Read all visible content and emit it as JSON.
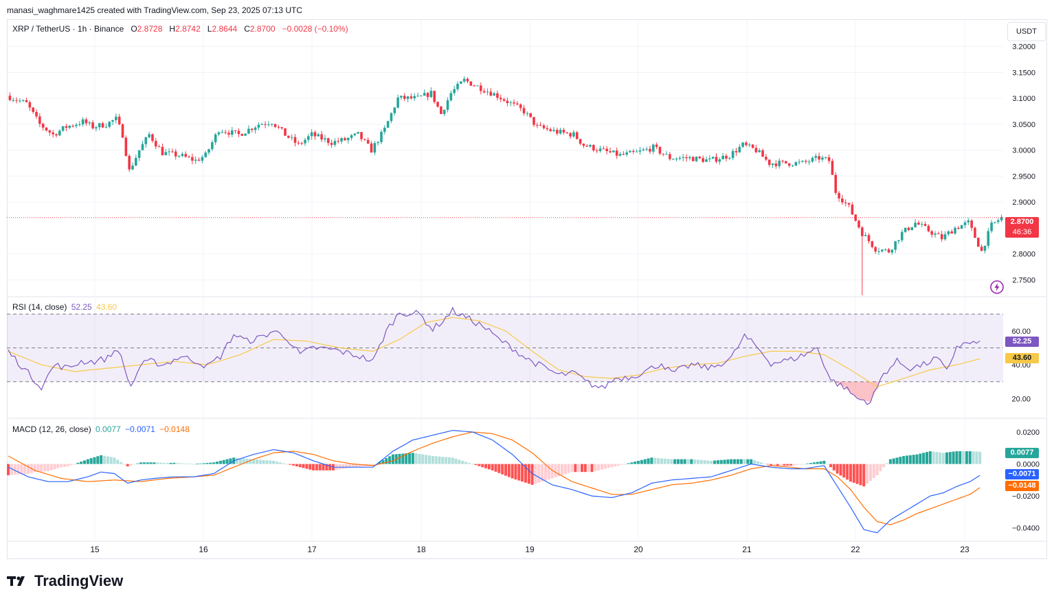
{
  "credit": "manasi_waghmare1425 created with TradingView.com, Sep 23, 2025 07:13 UTC",
  "brand": "TradingView",
  "colors": {
    "up": "#26a69a",
    "down": "#f23645",
    "rsi": "#7e57c2",
    "rsi_ma": "#f7c948",
    "macd": "#2962ff",
    "signal": "#ff6d00",
    "hist_up_strong": "#26a69a",
    "hist_up_weak": "#b2dfdb",
    "hist_down_strong": "#ff5252",
    "hist_down_weak": "#ffcdd2"
  },
  "price_pane": {
    "symbol": "XRP / TetherUS · 1h · Binance",
    "open_label": "O",
    "open": "2.8728",
    "high_label": "H",
    "high": "2.8742",
    "low_label": "L",
    "low": "2.8644",
    "close_label": "C",
    "close": "2.8700",
    "change": "−0.0028 (−0.10%)",
    "currency_button": "USDT",
    "last_price_tag": "2.8700",
    "countdown_tag": "46:36",
    "y_ticks": [
      "3.2000",
      "3.1500",
      "3.1000",
      "3.0500",
      "3.0000",
      "2.9500",
      "2.9000",
      "2.8000",
      "2.7500"
    ]
  },
  "rsi_pane": {
    "title": "RSI (14, close)",
    "rsi_value": "52.25",
    "ma_value": "43.60",
    "y_ticks": [
      "60.00",
      "40.00",
      "20.00"
    ]
  },
  "macd_pane": {
    "title": "MACD (12, 26, close)",
    "hist_value": "0.0077",
    "macd_value": "−0.0071",
    "signal_value": "−0.0148",
    "y_ticks": [
      "0.0200",
      "0.0000",
      "−0.0200",
      "−0.0400"
    ]
  },
  "x_ticks": [
    "15",
    "16",
    "17",
    "18",
    "19",
    "20",
    "21",
    "22",
    "23"
  ],
  "chart_data": {
    "type": "candlestick",
    "interval": "1h",
    "x_ticks": [
      "15",
      "16",
      "17",
      "18",
      "19",
      "20",
      "21",
      "22",
      "23"
    ],
    "price_ylim": [
      2.72,
      3.23
    ],
    "price_anchors": [
      [
        0,
        3.105
      ],
      [
        6,
        3.09
      ],
      [
        10,
        3.05
      ],
      [
        14,
        3.03
      ],
      [
        18,
        3.045
      ],
      [
        23,
        3.055
      ],
      [
        26,
        3.045
      ],
      [
        30,
        3.05
      ],
      [
        33,
        3.06
      ],
      [
        35,
        3.03
      ],
      [
        37,
        2.96
      ],
      [
        40,
        3.0
      ],
      [
        43,
        3.03
      ],
      [
        47,
        2.995
      ],
      [
        52,
        2.99
      ],
      [
        57,
        2.98
      ],
      [
        60,
        2.99
      ],
      [
        64,
        3.04
      ],
      [
        70,
        3.03
      ],
      [
        76,
        3.05
      ],
      [
        80,
        3.055
      ],
      [
        84,
        3.03
      ],
      [
        88,
        3.01
      ],
      [
        92,
        3.03
      ],
      [
        98,
        3.015
      ],
      [
        102,
        3.02
      ],
      [
        106,
        3.03
      ],
      [
        110,
        3.0
      ],
      [
        114,
        3.04
      ],
      [
        118,
        3.1
      ],
      [
        124,
        3.1
      ],
      [
        128,
        3.11
      ],
      [
        131,
        3.07
      ],
      [
        134,
        3.11
      ],
      [
        138,
        3.135
      ],
      [
        143,
        3.12
      ],
      [
        148,
        3.105
      ],
      [
        152,
        3.09
      ],
      [
        156,
        3.075
      ],
      [
        160,
        3.045
      ],
      [
        166,
        3.035
      ],
      [
        171,
        3.03
      ],
      [
        174,
        3.01
      ],
      [
        179,
        3.0
      ],
      [
        185,
        2.99
      ],
      [
        190,
        2.995
      ],
      [
        195,
        3.005
      ],
      [
        200,
        2.985
      ],
      [
        206,
        2.985
      ],
      [
        212,
        2.98
      ],
      [
        218,
        2.99
      ],
      [
        222,
        3.01
      ],
      [
        226,
        3.0
      ],
      [
        230,
        2.975
      ],
      [
        236,
        2.975
      ],
      [
        240,
        2.975
      ],
      [
        245,
        2.985
      ],
      [
        248,
        2.98
      ],
      [
        250,
        2.92
      ],
      [
        254,
        2.89
      ],
      [
        258,
        2.84
      ],
      [
        262,
        2.81
      ],
      [
        266,
        2.805
      ],
      [
        270,
        2.84
      ],
      [
        274,
        2.86
      ],
      [
        278,
        2.845
      ],
      [
        282,
        2.83
      ],
      [
        286,
        2.85
      ],
      [
        290,
        2.86
      ],
      [
        294,
        2.805
      ],
      [
        297,
        2.855
      ],
      [
        300,
        2.87
      ]
    ],
    "rsi_ylim": [
      10,
      77
    ],
    "rsi_levels": [
      70,
      50,
      30
    ],
    "rsi_anchors": [
      [
        0,
        48
      ],
      [
        6,
        35
      ],
      [
        10,
        27
      ],
      [
        14,
        40
      ],
      [
        18,
        38
      ],
      [
        22,
        42
      ],
      [
        26,
        42
      ],
      [
        30,
        44
      ],
      [
        33,
        50
      ],
      [
        35,
        38
      ],
      [
        37,
        27
      ],
      [
        40,
        40
      ],
      [
        43,
        42
      ],
      [
        47,
        40
      ],
      [
        52,
        45
      ],
      [
        57,
        42
      ],
      [
        60,
        39
      ],
      [
        64,
        45
      ],
      [
        68,
        58
      ],
      [
        72,
        54
      ],
      [
        76,
        56
      ],
      [
        80,
        60
      ],
      [
        84,
        56
      ],
      [
        88,
        46
      ],
      [
        92,
        50
      ],
      [
        98,
        49
      ],
      [
        102,
        47
      ],
      [
        106,
        45
      ],
      [
        110,
        42
      ],
      [
        114,
        60
      ],
      [
        118,
        71
      ],
      [
        124,
        70
      ],
      [
        128,
        61
      ],
      [
        131,
        66
      ],
      [
        134,
        72
      ],
      [
        138,
        68
      ],
      [
        143,
        63
      ],
      [
        148,
        55
      ],
      [
        152,
        50
      ],
      [
        156,
        44
      ],
      [
        160,
        40
      ],
      [
        166,
        34
      ],
      [
        171,
        35
      ],
      [
        174,
        30
      ],
      [
        179,
        26
      ],
      [
        183,
        32
      ],
      [
        188,
        33
      ],
      [
        193,
        37
      ],
      [
        197,
        41
      ],
      [
        200,
        35
      ],
      [
        206,
        40
      ],
      [
        212,
        38
      ],
      [
        218,
        44
      ],
      [
        222,
        57
      ],
      [
        226,
        50
      ],
      [
        230,
        41
      ],
      [
        236,
        43
      ],
      [
        240,
        46
      ],
      [
        244,
        50
      ],
      [
        248,
        31
      ],
      [
        252,
        27
      ],
      [
        256,
        20
      ],
      [
        260,
        18
      ],
      [
        264,
        35
      ],
      [
        268,
        42
      ],
      [
        272,
        38
      ],
      [
        276,
        40
      ],
      [
        280,
        44
      ],
      [
        283,
        36
      ],
      [
        286,
        51
      ],
      [
        290,
        53
      ],
      [
        293,
        52.25
      ]
    ],
    "rsi_ma_anchors": [
      [
        0,
        48
      ],
      [
        10,
        40
      ],
      [
        20,
        36
      ],
      [
        30,
        38
      ],
      [
        40,
        40
      ],
      [
        50,
        42
      ],
      [
        60,
        40
      ],
      [
        70,
        46
      ],
      [
        80,
        55
      ],
      [
        90,
        54
      ],
      [
        100,
        50
      ],
      [
        110,
        48
      ],
      [
        118,
        55
      ],
      [
        126,
        65
      ],
      [
        134,
        68
      ],
      [
        142,
        66
      ],
      [
        150,
        60
      ],
      [
        158,
        48
      ],
      [
        166,
        37
      ],
      [
        174,
        33
      ],
      [
        182,
        32
      ],
      [
        190,
        34
      ],
      [
        198,
        38
      ],
      [
        206,
        40
      ],
      [
        214,
        41
      ],
      [
        222,
        45
      ],
      [
        230,
        48
      ],
      [
        238,
        48
      ],
      [
        246,
        46
      ],
      [
        254,
        37
      ],
      [
        262,
        27
      ],
      [
        270,
        32
      ],
      [
        278,
        37
      ],
      [
        286,
        40
      ],
      [
        293,
        43.6
      ]
    ],
    "macd_ylim": [
      -0.047,
      0.026
    ],
    "macd_anchors": [
      [
        0,
        -0.002
      ],
      [
        6,
        -0.008
      ],
      [
        12,
        -0.011
      ],
      [
        18,
        -0.011
      ],
      [
        24,
        -0.008
      ],
      [
        28,
        -0.005
      ],
      [
        32,
        -0.006
      ],
      [
        36,
        -0.012
      ],
      [
        40,
        -0.01
      ],
      [
        44,
        -0.009
      ],
      [
        50,
        -0.008
      ],
      [
        56,
        -0.008
      ],
      [
        62,
        -0.006
      ],
      [
        68,
        0.002
      ],
      [
        74,
        0.006
      ],
      [
        80,
        0.009
      ],
      [
        86,
        0.007
      ],
      [
        92,
        0.002
      ],
      [
        98,
        -0.002
      ],
      [
        104,
        -0.002
      ],
      [
        110,
        -0.002
      ],
      [
        116,
        0.008
      ],
      [
        122,
        0.015
      ],
      [
        128,
        0.018
      ],
      [
        134,
        0.021
      ],
      [
        140,
        0.02
      ],
      [
        146,
        0.015
      ],
      [
        152,
        0.006
      ],
      [
        158,
        -0.006
      ],
      [
        164,
        -0.013
      ],
      [
        170,
        -0.016
      ],
      [
        176,
        -0.02
      ],
      [
        182,
        -0.021
      ],
      [
        188,
        -0.018
      ],
      [
        194,
        -0.012
      ],
      [
        200,
        -0.01
      ],
      [
        206,
        -0.009
      ],
      [
        212,
        -0.008
      ],
      [
        218,
        -0.004
      ],
      [
        224,
        0.0
      ],
      [
        230,
        -0.002
      ],
      [
        236,
        -0.003
      ],
      [
        240,
        -0.003
      ],
      [
        246,
        -0.001
      ],
      [
        250,
        -0.014
      ],
      [
        254,
        -0.027
      ],
      [
        258,
        -0.041
      ],
      [
        262,
        -0.043
      ],
      [
        266,
        -0.035
      ],
      [
        270,
        -0.03
      ],
      [
        274,
        -0.025
      ],
      [
        278,
        -0.02
      ],
      [
        282,
        -0.018
      ],
      [
        286,
        -0.014
      ],
      [
        290,
        -0.011
      ],
      [
        293,
        -0.0071
      ]
    ],
    "signal_anchors": [
      [
        0,
        0.005
      ],
      [
        8,
        -0.004
      ],
      [
        16,
        -0.009
      ],
      [
        24,
        -0.011
      ],
      [
        32,
        -0.01
      ],
      [
        40,
        -0.011
      ],
      [
        48,
        -0.009
      ],
      [
        56,
        -0.008
      ],
      [
        62,
        -0.007
      ],
      [
        68,
        -0.002
      ],
      [
        74,
        0.003
      ],
      [
        80,
        0.007
      ],
      [
        86,
        0.008
      ],
      [
        92,
        0.006
      ],
      [
        98,
        0.002
      ],
      [
        104,
        0.0
      ],
      [
        110,
        -0.001
      ],
      [
        116,
        0.002
      ],
      [
        122,
        0.008
      ],
      [
        128,
        0.013
      ],
      [
        134,
        0.017
      ],
      [
        140,
        0.02
      ],
      [
        146,
        0.019
      ],
      [
        152,
        0.015
      ],
      [
        158,
        0.007
      ],
      [
        164,
        -0.004
      ],
      [
        170,
        -0.011
      ],
      [
        176,
        -0.015
      ],
      [
        182,
        -0.019
      ],
      [
        188,
        -0.019
      ],
      [
        194,
        -0.016
      ],
      [
        200,
        -0.013
      ],
      [
        206,
        -0.012
      ],
      [
        212,
        -0.01
      ],
      [
        218,
        -0.007
      ],
      [
        224,
        -0.003
      ],
      [
        230,
        -0.001
      ],
      [
        236,
        -0.002
      ],
      [
        240,
        -0.003
      ],
      [
        246,
        -0.003
      ],
      [
        250,
        -0.008
      ],
      [
        254,
        -0.016
      ],
      [
        258,
        -0.027
      ],
      [
        262,
        -0.036
      ],
      [
        266,
        -0.038
      ],
      [
        270,
        -0.035
      ],
      [
        274,
        -0.031
      ],
      [
        278,
        -0.028
      ],
      [
        282,
        -0.025
      ],
      [
        286,
        -0.022
      ],
      [
        290,
        -0.019
      ],
      [
        293,
        -0.0148
      ]
    ]
  }
}
